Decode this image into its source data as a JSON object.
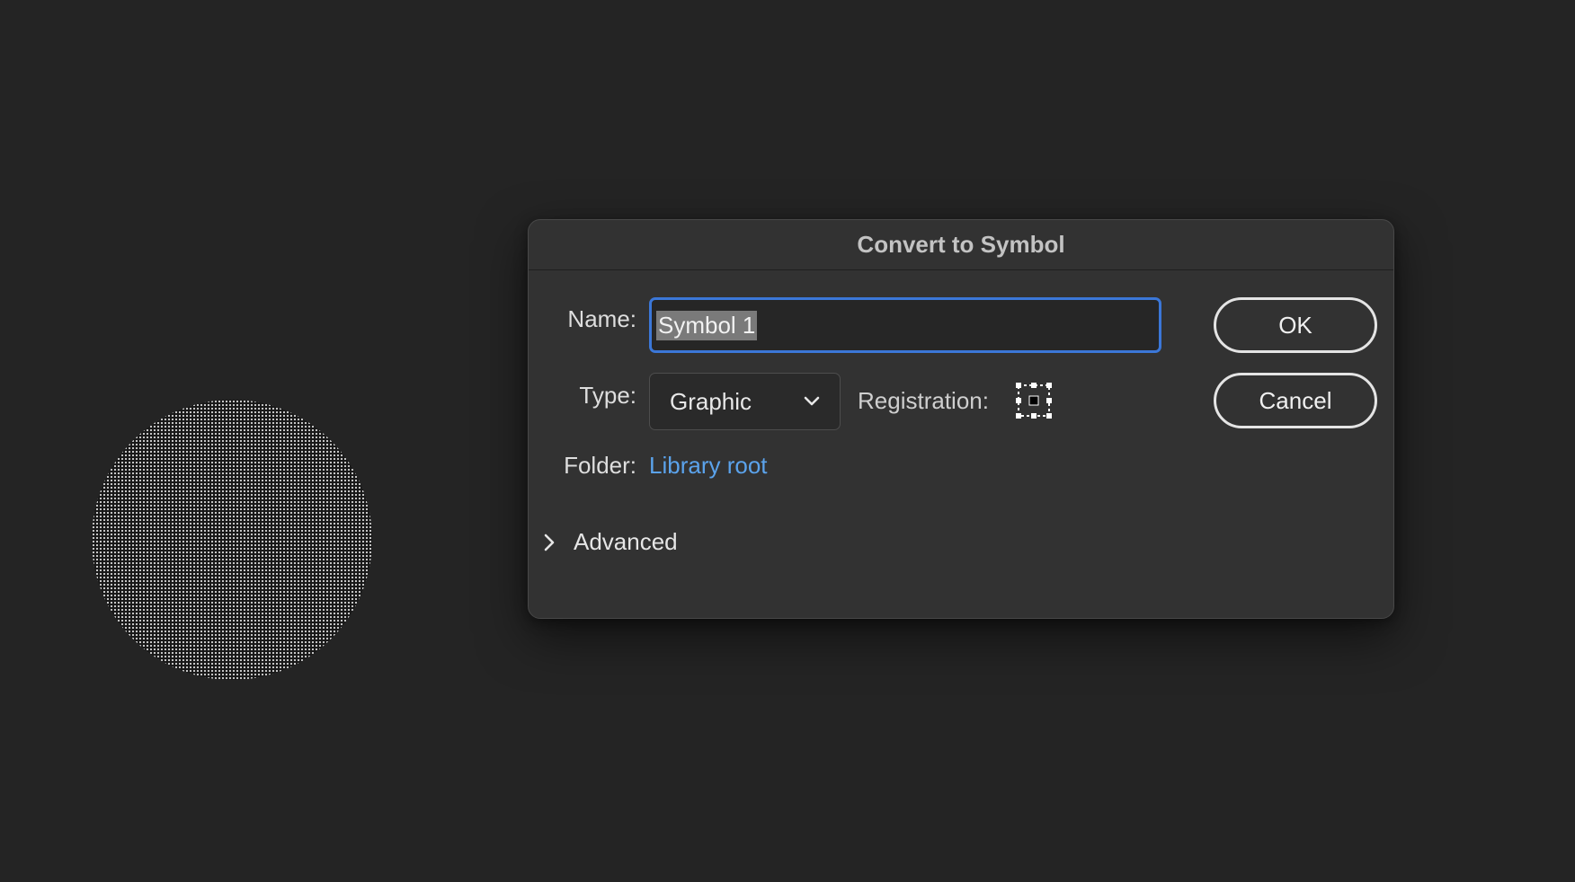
{
  "dialog": {
    "title": "Convert to Symbol",
    "name_label": "Name:",
    "name_value": "Symbol 1",
    "type_label": "Type:",
    "type_value": "Graphic",
    "registration_label": "Registration:",
    "folder_label": "Folder:",
    "folder_value": "Library root",
    "advanced_label": "Advanced",
    "ok_label": "OK",
    "cancel_label": "Cancel"
  },
  "icons": {
    "type_dropdown": "chevron-down-icon",
    "registration": "registration-grid-icon",
    "advanced_toggle": "chevron-right-icon"
  },
  "colors": {
    "background": "#242424",
    "dialog": "#323232",
    "focus_ring": "#3b77d8",
    "link": "#5ba3ec"
  }
}
